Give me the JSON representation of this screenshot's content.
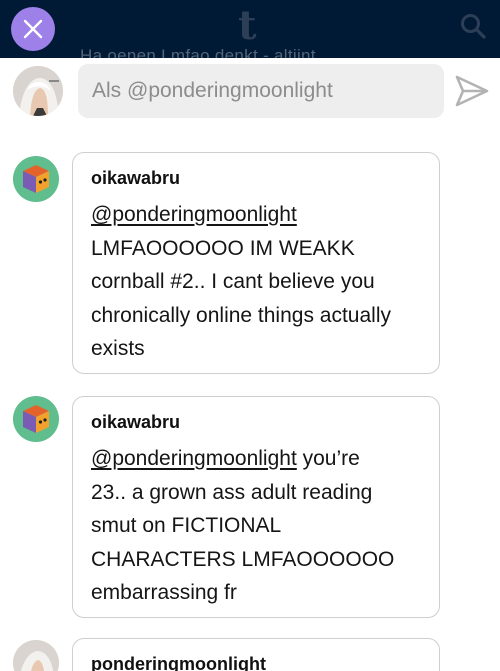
{
  "header": {
    "logo": "t",
    "peek_text": "Ha oenen Lmfao denkt - altijnt",
    "close_icon": "close-icon",
    "search_icon": "search-icon",
    "bar_color": "#001935",
    "close_color": "#9d80e8"
  },
  "composer": {
    "placeholder": "Als @ponderingmoonlight",
    "send_icon": "send-icon"
  },
  "comments": [
    {
      "author": "oikawabru",
      "mention": "@ponderingmoonlight",
      "text_line1": "LMFAOOOOOO IM WEAKK",
      "text_line2": "cornball #2.. I cant believe you",
      "text_line3": "chronically online things actually",
      "text_line4": "exists"
    },
    {
      "author": "oikawabru",
      "mention": "@ponderingmoonlight",
      "text_line1_rest": " you’re",
      "text_line2": "23.. a grown ass adult reading",
      "text_line3": "smut on FICTIONAL",
      "text_line4": "CHARACTERS LMFAOOOOOO",
      "text_line5": "embarrassing fr"
    },
    {
      "author": "ponderingmoonlight"
    }
  ]
}
